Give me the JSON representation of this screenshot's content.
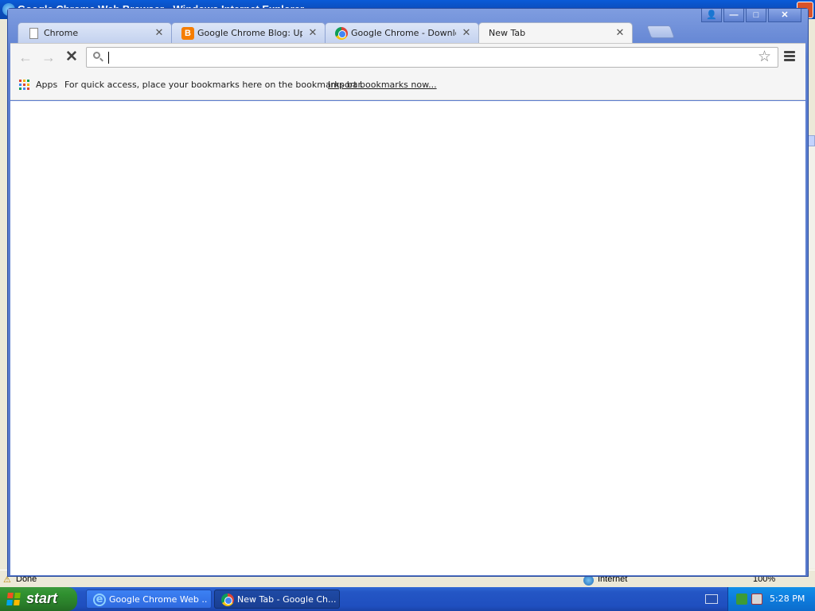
{
  "ie": {
    "title": "Google Chrome Web Browser - Windows Internet Explorer",
    "status": "Done",
    "zone": "Internet",
    "zoom": "100%"
  },
  "chrome": {
    "window_buttons": {
      "profile": "👤",
      "minimize": "—",
      "maximize": "□",
      "close": "✕"
    },
    "tabs": [
      {
        "title": "Chrome",
        "icon": "document-icon",
        "close": "✕"
      },
      {
        "title": "Google Chrome Blog: Update",
        "icon": "blogger-icon",
        "close": "✕"
      },
      {
        "title": "Google Chrome - Download t",
        "icon": "chrome-logo-icon",
        "close": "✕"
      },
      {
        "title": "New Tab",
        "icon": "",
        "close": "✕",
        "active": true
      }
    ],
    "toolbar": {
      "back": "←",
      "forward": "→",
      "stop": "✕",
      "omnibox_value": "",
      "star": "☆"
    },
    "bookmarks_bar": {
      "apps_label": "Apps",
      "hint": "For quick access, place your bookmarks here on the bookmarks bar.",
      "import_link": "Import bookmarks now..."
    }
  },
  "taskbar": {
    "start_label": "start",
    "tasks": [
      {
        "label": "Google Chrome Web ...",
        "icon": "ie-icon",
        "active": false
      },
      {
        "label": "New Tab - Google Ch...",
        "icon": "chrome-logo-icon",
        "active": true
      }
    ],
    "clock": "5:28 PM"
  },
  "colors": {
    "xp_blue": "#2456c5",
    "start_green": "#2f8f2f",
    "chrome_frame": "#6f8fd6",
    "tray_blue": "#0f7fe0"
  }
}
